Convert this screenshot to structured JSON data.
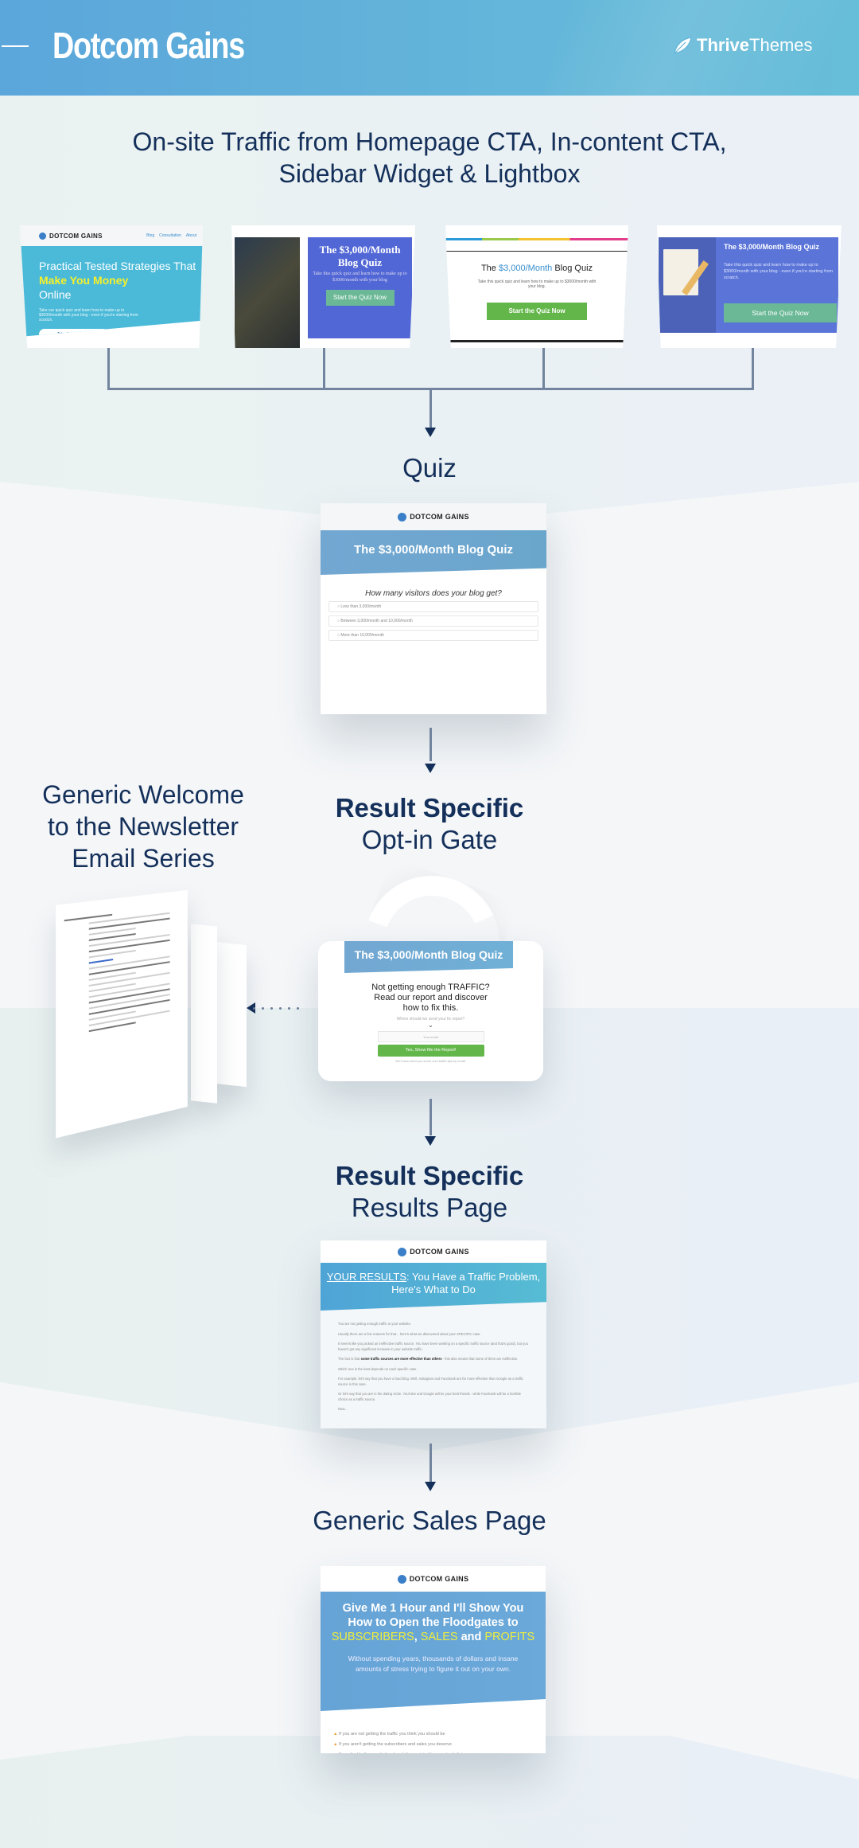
{
  "header": {
    "title": "Dotcom Gains",
    "partner_logo_bold": "Thrive",
    "partner_logo_light": "Themes",
    "partner_logo_icon": "leaf-icon"
  },
  "top_title_line1": "On-site Traffic from Homepage CTA, In-content CTA,",
  "top_title_line2": "Sidebar Widget & Lightbox",
  "traffic_sources": [
    {
      "name": "Homepage CTA",
      "brand": "DOTCOM GAINS",
      "nav": [
        "Blog",
        "Consultation",
        "About"
      ],
      "headline_plain": "Practical Tested Strategies That",
      "headline_highlight": "Make You Money",
      "headline_end": "Online",
      "text": "Take our quick quiz and learn how to make up to $3000/month with your blog - even if you're starting from scratch.",
      "button": "Take the Quiz Now"
    },
    {
      "name": "In-content CTA",
      "headline": "The $3,000/Month Blog Quiz",
      "text": "Take this quick quiz and learn how to make up to $3000/month with your blog",
      "button": "Start the Quiz Now"
    },
    {
      "name": "Sidebar Widget",
      "headline_pre": "The",
      "headline_highlight": "$3,000/Month",
      "headline_post": "Blog Quiz",
      "text": "Take this quick quiz and learn how to make up to $3000/month with your blog.",
      "button": "Start the Quiz Now"
    },
    {
      "name": "Lightbox",
      "headline": "The $3,000/Month Blog Quiz",
      "text": "Take this quick quiz and learn how to make up to $3000/month with your blog - even if you're starting from scratch.",
      "button": "Start the Quiz Now"
    }
  ],
  "quiz": {
    "label": "Quiz",
    "brand": "DOTCOM GAINS",
    "title": "The $3,000/Month Blog Quiz",
    "question": "How many visitors does your blog get?",
    "options": [
      "Less than 3,000/month",
      "Between 3,000/month and 10,000/month",
      "More than 10,000/month"
    ]
  },
  "newsletter": {
    "label_line1": "Generic Welcome",
    "label_line2": "to the Newsletter",
    "label_line3": "Email Series"
  },
  "optin_gate": {
    "label_strong": "Result Specific",
    "label_light": "Opt-in Gate",
    "title": "The $3,000/Month Blog Quiz",
    "headline_line1": "Not getting enough TRAFFIC?",
    "headline_line2": "Read our report and discover",
    "headline_line3": "how to fix this.",
    "prompt": "Where should we send your fix report?",
    "email_placeholder": "Your email",
    "button": "Yes, Show Me the Report!",
    "footnote": "We'll also send you some cool traffic tips by email."
  },
  "results_page": {
    "label_strong": "Result Specific",
    "label_light": "Results Page",
    "brand": "DOTCOM GAINS",
    "headline_underlined": "YOUR RESULTS",
    "headline_rest": ": You Have a Traffic Problem, Here's What to Do",
    "paragraphs": [
      "You are not getting enough traffic to your website.",
      "Usually there are a few reasons for that... here's what we discovered about your SPECIFIC case.",
      "It seems like you picked an ineffective traffic source. You have been working on a specific traffic source (and that's good), but you haven't got any significant increase in your website traffic.",
      "Which one is the best depends on each specific case.",
      "For example, let's say that you have a food blog. Well, Instagram and Facebook are far more effective than Google as a traffic source in this case.",
      "Or let's say that you are in the dating niche. YouTube and Google will be your best friends - while Facebook will be a horrible choice as a traffic source.",
      "Now..."
    ],
    "bold_pre": "The fact is that ",
    "bold_text": "some traffic sources are more effective than others",
    "bold_post": " - this also means that some of them are ineffective."
  },
  "sales_page": {
    "label": "Generic Sales Page",
    "brand": "DOTCOM GAINS",
    "headline_line1": "Give Me 1 Hour and I'll Show You",
    "headline_line2": "How to Open the Floodgates to",
    "highlight1": "SUBSCRIBERS",
    "highlight2": "SALES",
    "highlight_and": "and",
    "highlight3": "PROFITS",
    "subtext": "Without spending years, thousands of dollars and insane amounts of stress trying to figure it out on your own.",
    "bullets": [
      "If you are not getting the traffic you think you should be",
      "If you aren't getting the subscribers and sales you deserve",
      "If you feel both overwhelmed and disappointed by your to do list"
    ]
  },
  "colors": {
    "header_blue": "#5ba6db",
    "title_navy": "#14305a",
    "connector": "#72849e",
    "cta_green": "#63b649",
    "highlight_yellow": "#f0ee3a"
  }
}
